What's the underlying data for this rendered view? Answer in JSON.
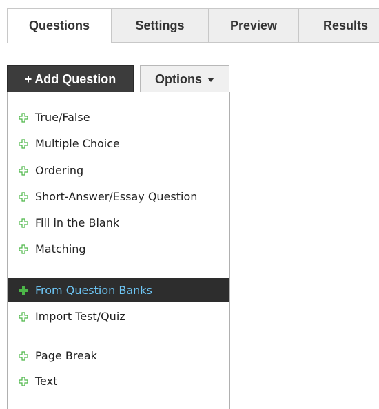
{
  "tabs": [
    {
      "label": "Questions",
      "active": true
    },
    {
      "label": "Settings",
      "active": false
    },
    {
      "label": "Preview",
      "active": false
    },
    {
      "label": "Results",
      "active": false
    }
  ],
  "toolbar": {
    "add_question_label": "Add Question",
    "add_question_prefix": "+",
    "options_label": "Options"
  },
  "menu": {
    "group1": [
      {
        "label": "True/False",
        "icon": "plus-outline-icon"
      },
      {
        "label": "Multiple Choice",
        "icon": "plus-outline-icon"
      },
      {
        "label": "Ordering",
        "icon": "plus-outline-icon"
      },
      {
        "label": "Short-Answer/Essay Question",
        "icon": "plus-outline-icon"
      },
      {
        "label": "Fill in the Blank",
        "icon": "plus-outline-icon"
      },
      {
        "label": "Matching",
        "icon": "plus-outline-icon"
      }
    ],
    "group2": [
      {
        "label": "From Question Banks",
        "icon": "plus-solid-icon",
        "highlighted": true
      },
      {
        "label": "Import Test/Quiz",
        "icon": "plus-outline-icon"
      }
    ],
    "group3": [
      {
        "label": "Page Break",
        "icon": "plus-outline-icon"
      },
      {
        "label": "Text",
        "icon": "plus-outline-icon"
      }
    ]
  },
  "colors": {
    "icon_green": "#4cb648",
    "highlight_bg": "#2d2d2d",
    "highlight_text": "#6ec6f5",
    "add_button_bg": "#3c3c3c"
  }
}
